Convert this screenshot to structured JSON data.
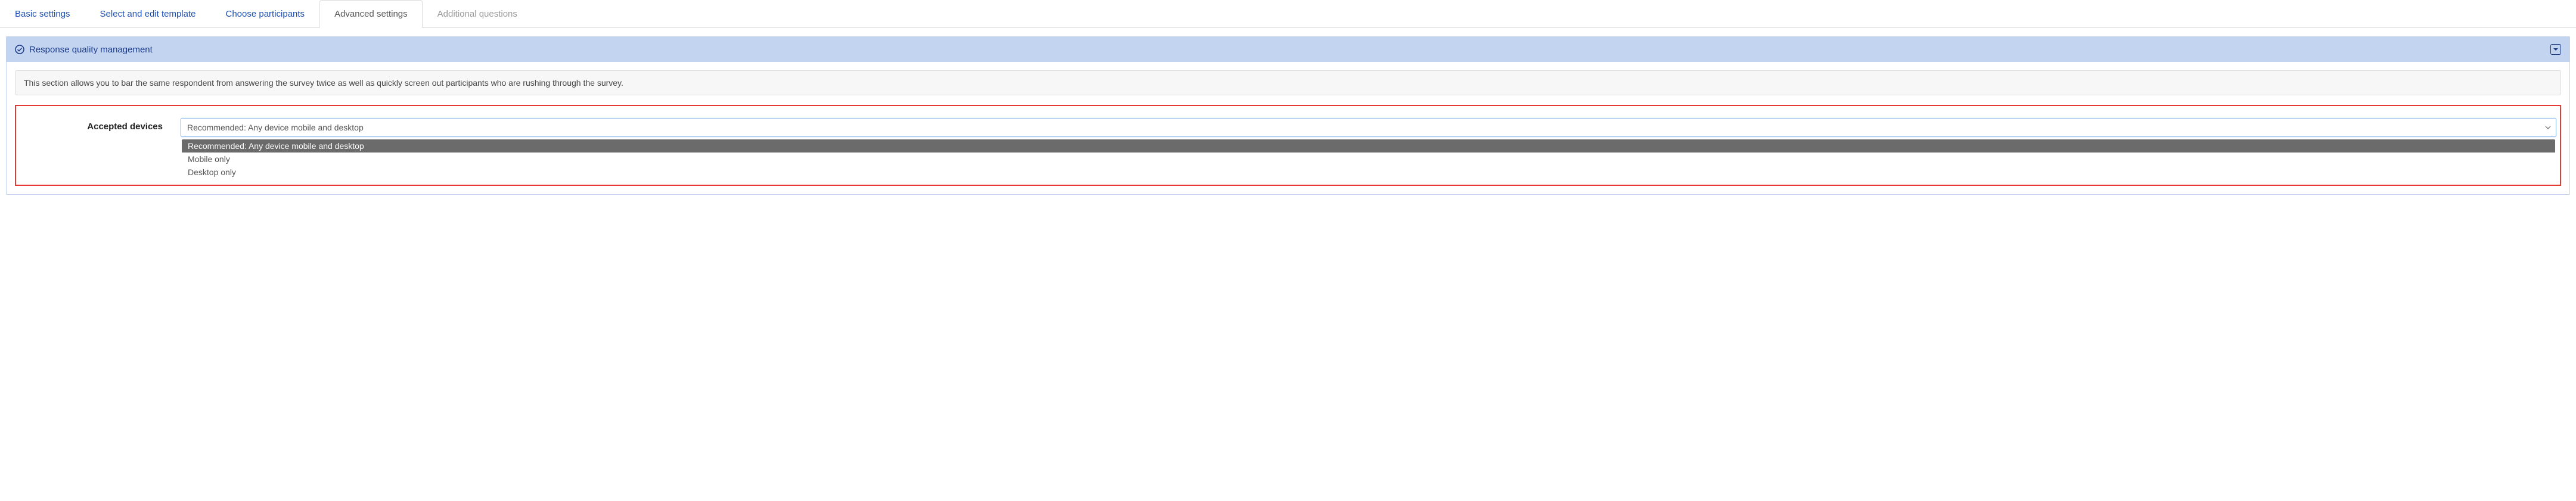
{
  "tabs": [
    {
      "label": "Basic settings"
    },
    {
      "label": "Select and edit template"
    },
    {
      "label": "Choose participants"
    },
    {
      "label": "Advanced settings"
    },
    {
      "label": "Additional questions"
    }
  ],
  "panel": {
    "title": "Response quality management",
    "info": "This section allows you to bar the same respondent from answering the survey twice as well as quickly screen out participants who are rushing through the survey."
  },
  "form": {
    "accepted_devices_label": "Accepted devices",
    "accepted_devices_value": "Recommended: Any device mobile and desktop",
    "options": [
      "Recommended: Any device mobile and desktop",
      "Mobile only",
      "Desktop only"
    ]
  }
}
